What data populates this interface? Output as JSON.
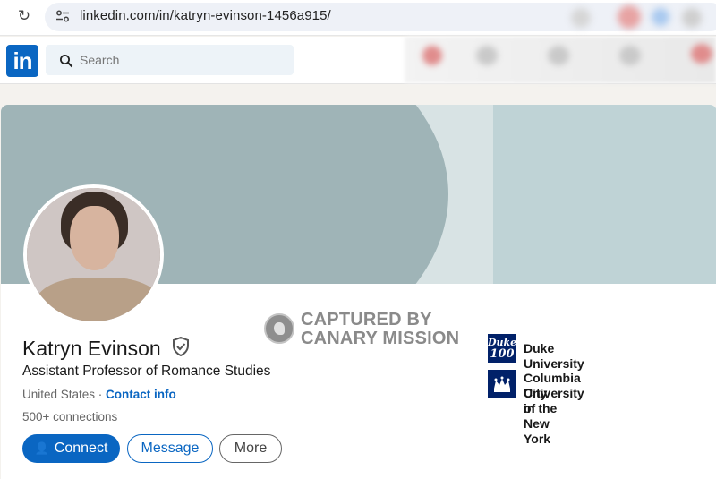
{
  "browser": {
    "url": "linkedin.com/in/katryn-evinson-1456a915/",
    "reload_icon": "reload-icon",
    "site_info_icon": "tune-icon"
  },
  "nav": {
    "logo": "in",
    "search_placeholder": "Search"
  },
  "profile": {
    "name": "Katryn Evinson",
    "headline": "Assistant Professor of Romance Studies",
    "location": "United States",
    "separator": " · ",
    "contact_info": "Contact info",
    "connections": "500+ connections"
  },
  "actions": {
    "connect": "Connect",
    "message": "Message",
    "more": "More"
  },
  "watermark": {
    "line1": "CAPTURED BY",
    "line2": "CANARY MISSION"
  },
  "education": [
    {
      "logo_text": "Duke 100",
      "name_line1": "Duke University",
      "name_line2": ""
    },
    {
      "logo_text": "",
      "name_line1": "Columbia University in the",
      "name_line2": "City of New York"
    }
  ],
  "colors": {
    "linkedin_blue": "#0a66c2",
    "banner_dark": "#9fb4b7",
    "banner_light": "#bfd3d6",
    "duke_navy": "#012169"
  }
}
